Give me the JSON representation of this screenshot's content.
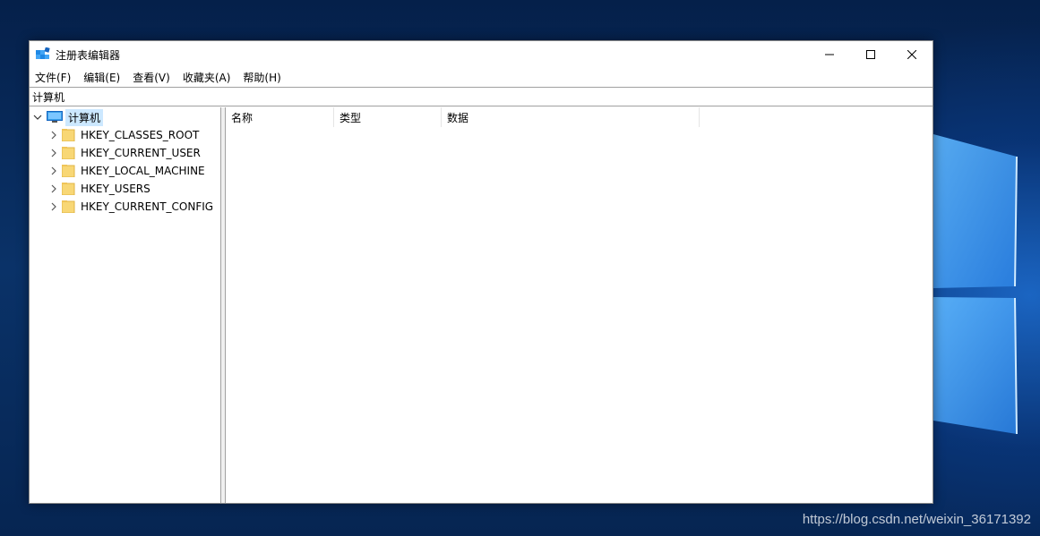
{
  "window": {
    "title": "注册表编辑器"
  },
  "menu": {
    "items": [
      {
        "label": "文件(F)"
      },
      {
        "label": "编辑(E)"
      },
      {
        "label": "查看(V)"
      },
      {
        "label": "收藏夹(A)"
      },
      {
        "label": "帮助(H)"
      }
    ]
  },
  "address": {
    "value": "计算机"
  },
  "tree": {
    "root_label": "计算机",
    "children": [
      {
        "label": "HKEY_CLASSES_ROOT"
      },
      {
        "label": "HKEY_CURRENT_USER"
      },
      {
        "label": "HKEY_LOCAL_MACHINE"
      },
      {
        "label": "HKEY_USERS"
      },
      {
        "label": "HKEY_CURRENT_CONFIG"
      }
    ]
  },
  "list": {
    "columns": [
      {
        "label": "名称"
      },
      {
        "label": "类型"
      },
      {
        "label": "数据"
      }
    ]
  },
  "watermark": "https://blog.csdn.net/weixin_36171392",
  "colors": {
    "selection": "#cce8ff",
    "folder": "#f8d775",
    "desktop": "#0a3268"
  }
}
